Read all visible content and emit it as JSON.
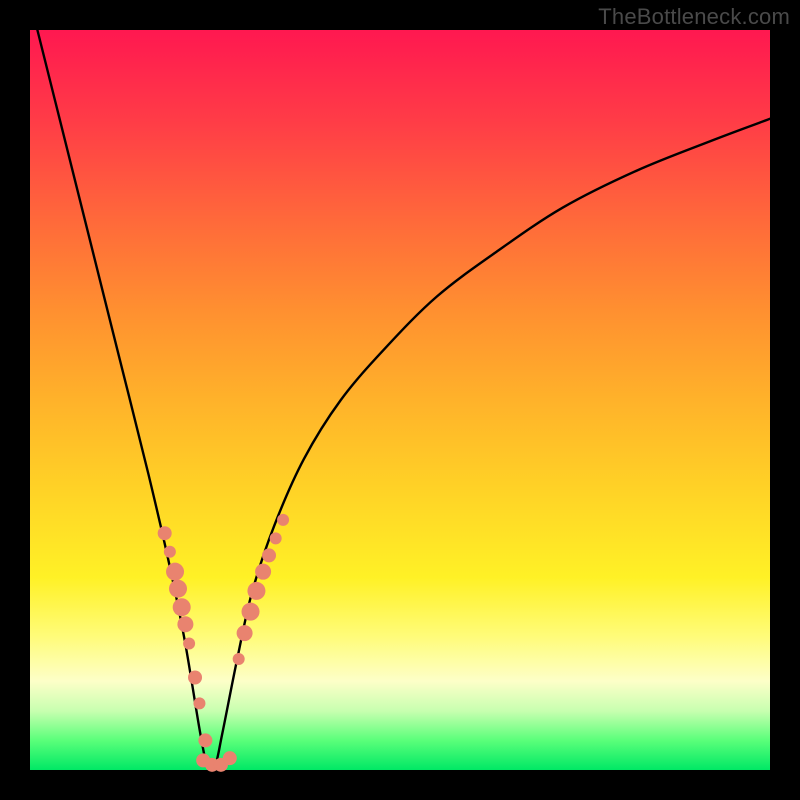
{
  "watermark": "TheBottleneck.com",
  "colors": {
    "background_black": "#000000",
    "curve_stroke": "#000000",
    "bead_fill": "#e9836f",
    "gradient_top": "#ff1850",
    "gradient_bottom": "#00e865"
  },
  "chart_data": {
    "type": "line",
    "title": "",
    "xlabel": "",
    "ylabel": "",
    "xlim": [
      0,
      100
    ],
    "ylim": [
      0,
      100
    ],
    "note": "x in percent of plot width left→right; y in percent of plot height (0 = top, 100 = bottom). Curve is a V/absolute-difference shaped bottleneck curve with minimum near x≈24.",
    "series": [
      {
        "name": "bottleneck-curve",
        "x": [
          1,
          4,
          8,
          12,
          16,
          19,
          21,
          23,
          24,
          25,
          26,
          28,
          30,
          33,
          37,
          42,
          48,
          55,
          63,
          72,
          82,
          92,
          100
        ],
        "y": [
          0,
          12,
          28,
          44,
          60,
          73,
          83,
          95,
          99.5,
          99.5,
          95,
          85,
          76,
          67,
          58,
          50,
          43,
          36,
          30,
          24,
          19,
          15,
          12
        ]
      }
    ],
    "beads_left": {
      "name": "left-cluster",
      "note": "scatter points sitting on the left branch; values are pairs [x,y] in same percent coords; r is radius in px.",
      "points": [
        {
          "x": 18.2,
          "y": 68.0,
          "r": 7
        },
        {
          "x": 18.9,
          "y": 70.5,
          "r": 6
        },
        {
          "x": 19.6,
          "y": 73.2,
          "r": 9
        },
        {
          "x": 20.0,
          "y": 75.5,
          "r": 9
        },
        {
          "x": 20.5,
          "y": 78.0,
          "r": 9
        },
        {
          "x": 21.0,
          "y": 80.3,
          "r": 8
        },
        {
          "x": 21.5,
          "y": 82.9,
          "r": 6
        },
        {
          "x": 22.3,
          "y": 87.5,
          "r": 7
        },
        {
          "x": 22.9,
          "y": 91.0,
          "r": 6
        },
        {
          "x": 23.7,
          "y": 96.0,
          "r": 7
        }
      ]
    },
    "beads_right": {
      "name": "right-cluster",
      "points": [
        {
          "x": 28.2,
          "y": 85.0,
          "r": 6
        },
        {
          "x": 29.0,
          "y": 81.5,
          "r": 8
        },
        {
          "x": 29.8,
          "y": 78.6,
          "r": 9
        },
        {
          "x": 30.6,
          "y": 75.8,
          "r": 9
        },
        {
          "x": 31.5,
          "y": 73.2,
          "r": 8
        },
        {
          "x": 32.3,
          "y": 71.0,
          "r": 7
        },
        {
          "x": 33.2,
          "y": 68.7,
          "r": 6
        },
        {
          "x": 34.2,
          "y": 66.2,
          "r": 6
        }
      ]
    },
    "beads_bottom": {
      "name": "bottom-cluster",
      "points": [
        {
          "x": 23.4,
          "y": 98.7,
          "r": 7
        },
        {
          "x": 24.6,
          "y": 99.3,
          "r": 7
        },
        {
          "x": 25.8,
          "y": 99.3,
          "r": 7
        },
        {
          "x": 27.0,
          "y": 98.4,
          "r": 7
        }
      ]
    }
  }
}
